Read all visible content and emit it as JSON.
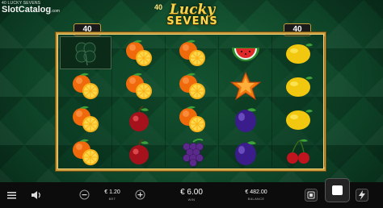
{
  "brand": {
    "small": "40 LUCKY SEVENS",
    "name_part1": "Slot",
    "name_part2": "Catalog",
    "suffix": ".com"
  },
  "game_logo": {
    "line1": "Lucky",
    "line2": "SEVENS",
    "number": "40"
  },
  "lines_left": "40",
  "lines_right": "40",
  "reels": [
    [
      "clover",
      "orange",
      "orange",
      "orange"
    ],
    [
      "orange",
      "orange",
      "cherry",
      "cherry"
    ],
    [
      "orange",
      "orange",
      "orange",
      "grapes"
    ],
    [
      "watermelon",
      "star",
      "plum",
      "plum"
    ],
    [
      "lemon",
      "lemon",
      "lemon",
      "cherries"
    ]
  ],
  "bet": {
    "value": "€ 1.20",
    "label": "BET"
  },
  "win": {
    "value": "€ 6.00",
    "label": "WIN"
  },
  "balance": {
    "value": "€ 482.00",
    "label": "BALANCE"
  },
  "colors": {
    "frame": "#c99b3b",
    "background": "#0e4428",
    "bar": "#0c0c0c"
  },
  "icons": [
    "menu-icon",
    "sound-icon",
    "minus-icon",
    "plus-icon",
    "autoplay-icon",
    "spin-icon",
    "turbo-icon"
  ]
}
